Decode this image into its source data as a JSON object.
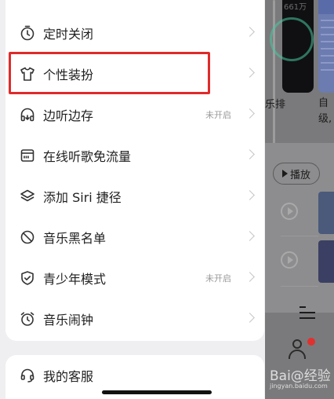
{
  "background_app": {
    "card_number": "661万",
    "text_left": "乐排",
    "text_right_line1": "自",
    "text_right_line2": "级,",
    "play_button_label": "播放",
    "watermark": "Bai@经验",
    "watermark_sub": "jingyan.baidu.com"
  },
  "menu": {
    "items": [
      {
        "label": "定时关闭",
        "status": "",
        "icon": "timer-icon"
      },
      {
        "label": "个性装扮",
        "status": "",
        "icon": "tshirt-icon"
      },
      {
        "label": "边听边存",
        "status": "未开启",
        "icon": "headphones-icon"
      },
      {
        "label": "在线听歌免流量",
        "status": "",
        "icon": "sim-card-icon"
      },
      {
        "label": "添加 Siri 捷径",
        "status": "",
        "icon": "layers-icon"
      },
      {
        "label": "音乐黑名单",
        "status": "",
        "icon": "block-icon"
      },
      {
        "label": "青少年模式",
        "status": "未开启",
        "icon": "shield-check-icon"
      },
      {
        "label": "音乐闹钟",
        "status": "",
        "icon": "alarm-clock-icon"
      }
    ],
    "service": {
      "label": "我的客服",
      "icon": "headset-icon"
    }
  },
  "colors": {
    "highlight": "#e02a2a",
    "dim_overlay": "#7a7a7c",
    "badge_red": "#e0312e"
  }
}
